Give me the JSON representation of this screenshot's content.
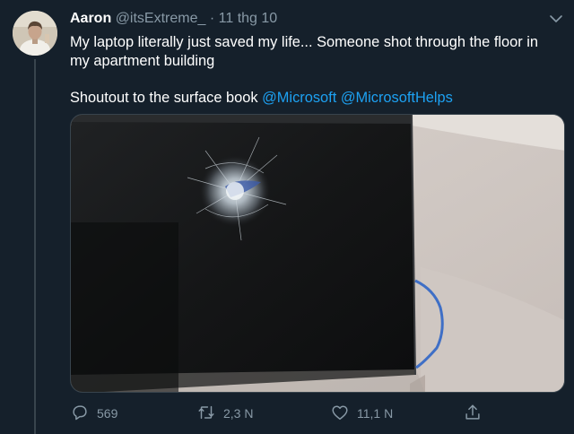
{
  "tweet": {
    "author_name": "Aaron",
    "author_handle": "@itsExtreme_",
    "separator": "·",
    "timestamp": "11 thg 10",
    "text_line1": "My laptop literally just saved my life... Someone shot through the floor in my apartment building",
    "text_line2_prefix": "Shoutout to the surface book ",
    "mention1": "@Microsoft",
    "mention_space": " ",
    "mention2": "@MicrosoftHelps"
  },
  "actions": {
    "replies": "569",
    "retweets": "2,3 N",
    "likes": "11,1 N"
  },
  "colors": {
    "background": "#15202b",
    "text": "#ffffff",
    "secondary": "#8899a6",
    "accent": "#1da1f2",
    "divider": "#38444d"
  },
  "icons": {
    "more": "chevron-down-icon",
    "reply": "reply-icon",
    "retweet": "retweet-icon",
    "like": "heart-icon",
    "share": "share-icon"
  }
}
